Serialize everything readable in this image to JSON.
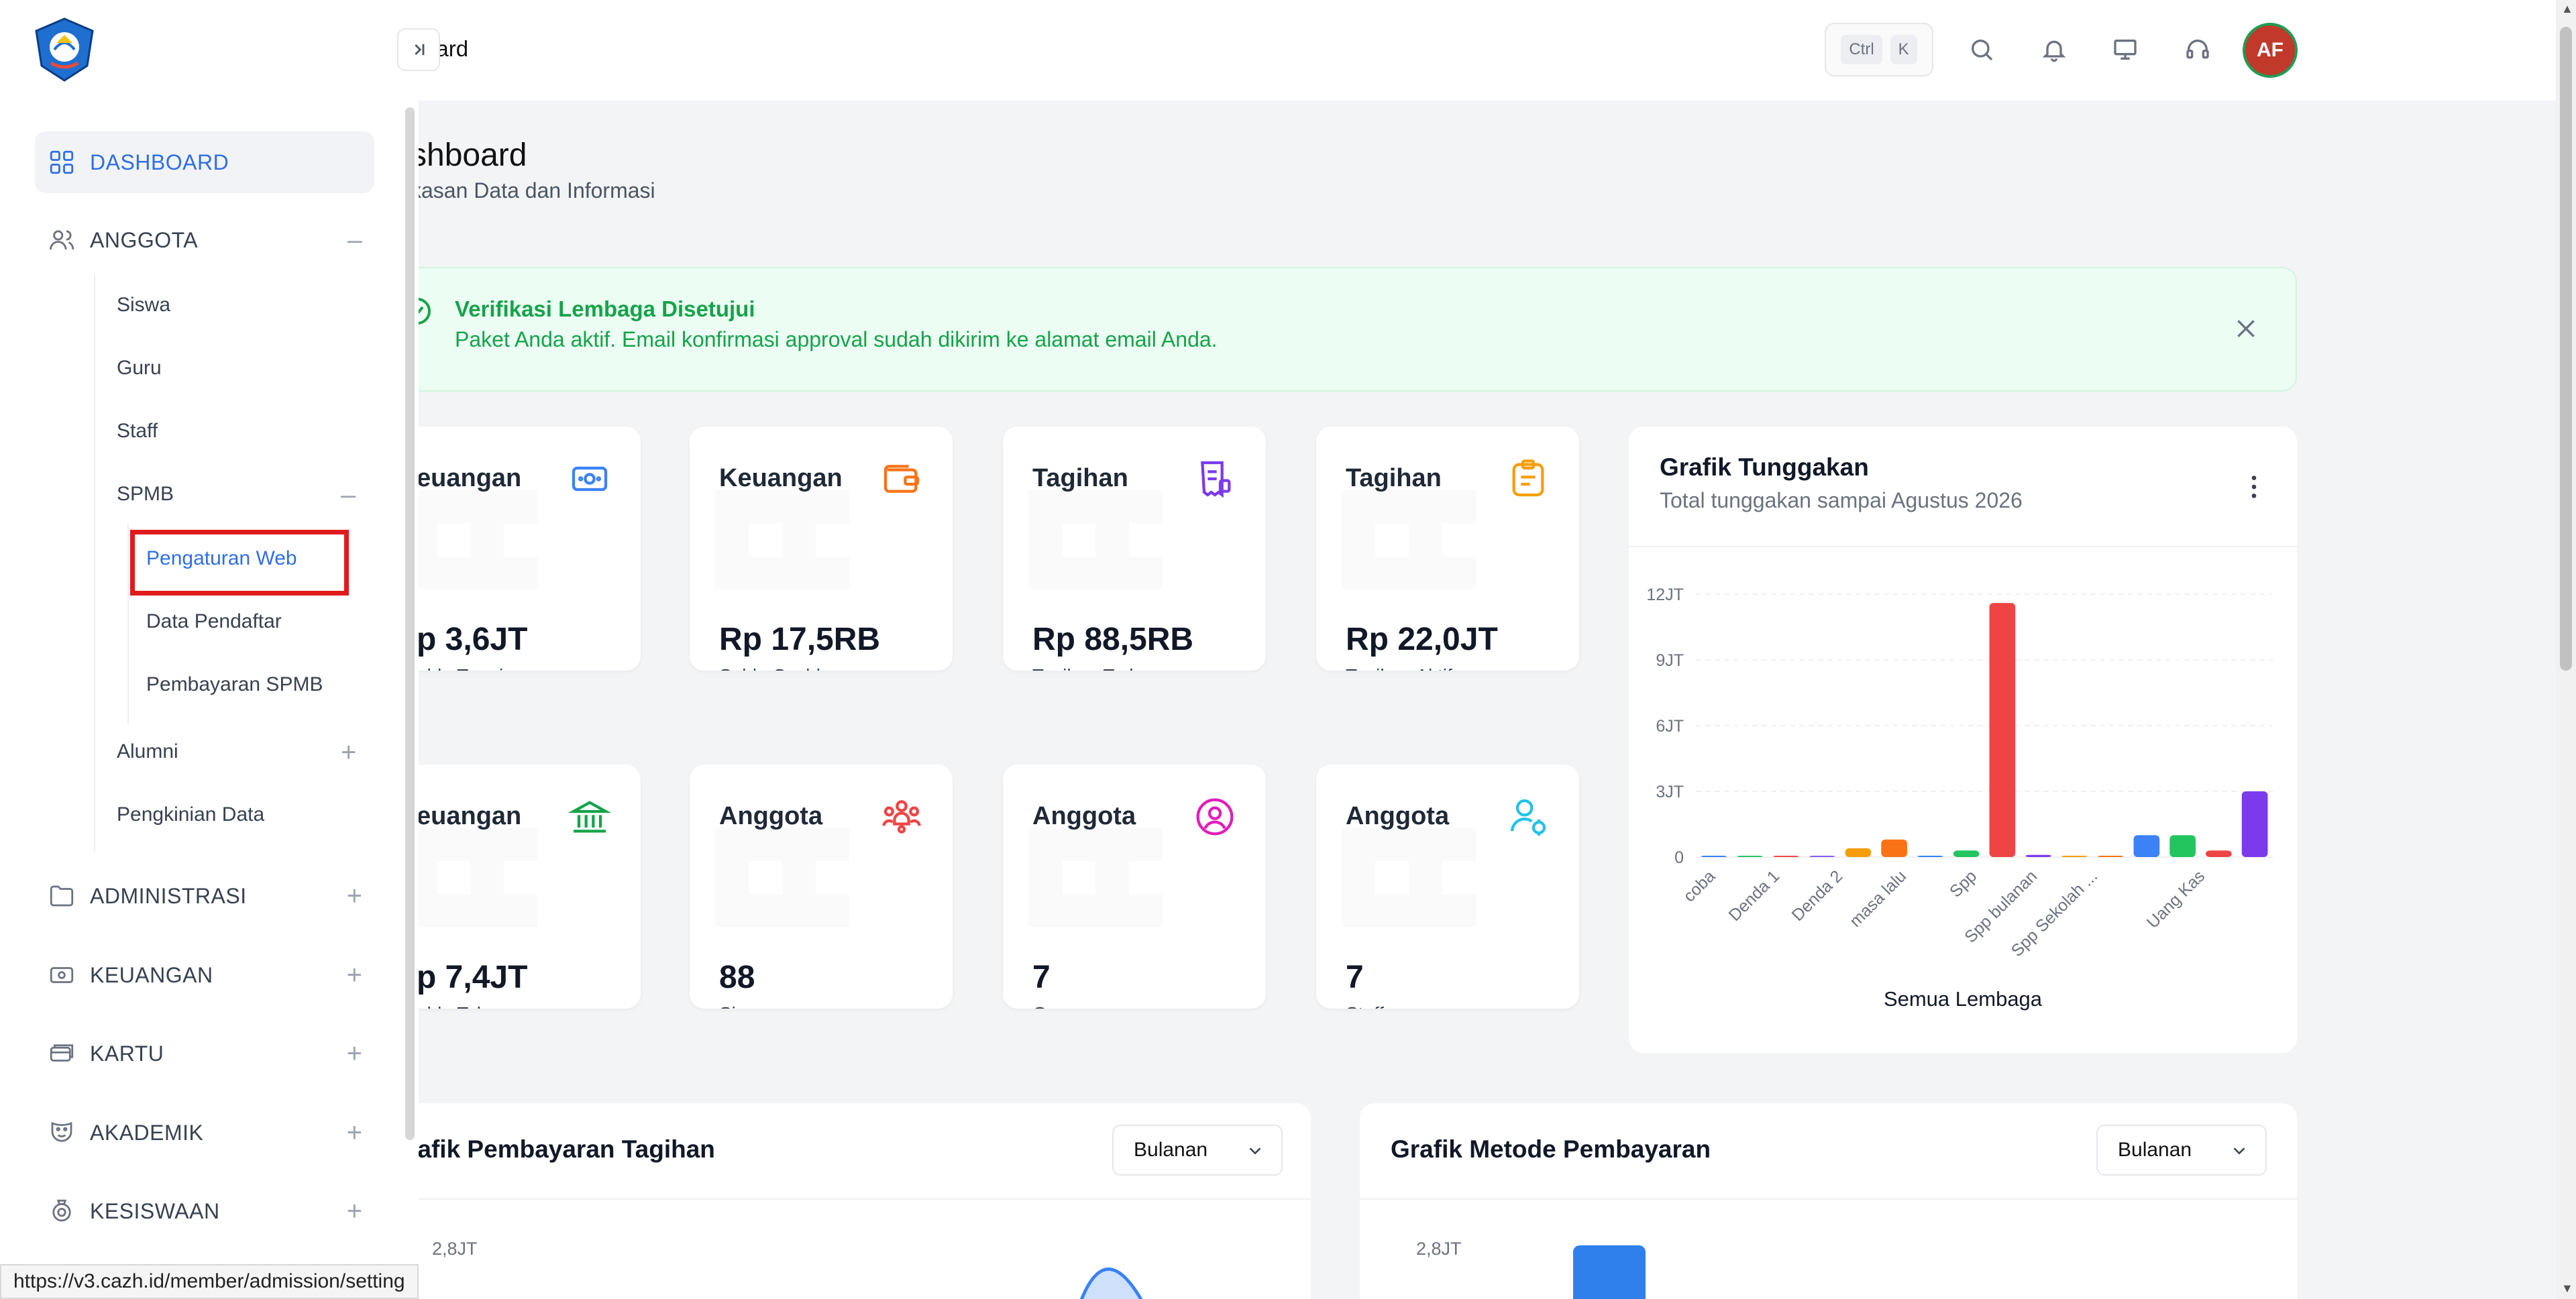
{
  "status_url": "https://v3.cazh.id/member/admission/setting",
  "topbar": {
    "breadcrumb": "oard",
    "shortcut": [
      "Ctrl",
      "K"
    ],
    "avatar_initials": "AF",
    "icons": [
      "search-icon",
      "bell-icon",
      "monitor-icon",
      "headset-icon"
    ]
  },
  "sidebar": {
    "nav": [
      {
        "label": "DASHBOARD",
        "icon": "grid-icon",
        "active": true
      },
      {
        "label": "ANGGOTA",
        "icon": "users-icon",
        "toggle": "–"
      },
      {
        "label": "ADMINISTRASI",
        "icon": "folder-icon",
        "toggle": "+"
      },
      {
        "label": "KEUANGAN",
        "icon": "money-icon",
        "toggle": "+"
      },
      {
        "label": "KARTU",
        "icon": "card-icon",
        "toggle": "+"
      },
      {
        "label": "AKADEMIK",
        "icon": "mask-icon",
        "toggle": "+"
      },
      {
        "label": "KESISWAAN",
        "icon": "badge-icon",
        "toggle": "+"
      }
    ],
    "anggota_children": [
      {
        "label": "Siswa"
      },
      {
        "label": "Guru"
      },
      {
        "label": "Staff"
      },
      {
        "label": "SPMB",
        "toggle": "–"
      },
      {
        "label": "Alumni",
        "toggle": "+"
      },
      {
        "label": "Pengkinian Data"
      }
    ],
    "spmb_children": [
      {
        "label": "Pengaturan Web",
        "active": true
      },
      {
        "label": "Data Pendaftar"
      },
      {
        "label": "Pembayaran SPMB"
      }
    ]
  },
  "page": {
    "title": "shboard",
    "subtitle": "kasan Data dan Informasi"
  },
  "alert": {
    "title": "Verifikasi Lembaga Disetujui",
    "message": "Paket Anda aktif. Email konfirmasi approval sudah dikirim ke alamat email Anda."
  },
  "cards": [
    {
      "title": "euangan",
      "value": "p 3,6JT",
      "label": "aldo Tunai",
      "icon": "cash-icon",
      "color": "#3b82f6"
    },
    {
      "title": "Keuangan",
      "value": "Rp 17,5RB",
      "label": "Saldo Cazhbox",
      "icon": "wallet-icon",
      "color": "#f97316"
    },
    {
      "title": "Tagihan",
      "value": "Rp 88,5RB",
      "label": "Tagihan Terbayar",
      "icon": "receipt-icon",
      "color": "#7c3aed"
    },
    {
      "title": "Tagihan",
      "value": "Rp 22,0JT",
      "label": "Tagihan Aktif",
      "icon": "clipboard-icon",
      "color": "#f59e0b"
    },
    {
      "title": "euangan",
      "value": "p 7,4JT",
      "label": "aldo Tabungan",
      "icon": "bank-icon",
      "color": "#16a34a"
    },
    {
      "title": "Anggota",
      "value": "88",
      "label": "Siswa",
      "icon": "group-icon",
      "color": "#ef4444"
    },
    {
      "title": "Anggota",
      "value": "7",
      "label": "Guru",
      "icon": "user-circle-icon",
      "color": "#e11dbb"
    },
    {
      "title": "Anggota",
      "value": "7",
      "label": "Staff",
      "icon": "user-gear-icon",
      "color": "#22c3e6"
    }
  ],
  "tunggakan": {
    "title": "Grafik Tunggakan",
    "subtitle": "Total tunggakan sampai Agustus 2026",
    "footer": "Semua Lembaga"
  },
  "pembayaran_tagihan": {
    "title": "rafik Pembayaran Tagihan",
    "select": "Bulanan",
    "tick": "2,8JT"
  },
  "metode_pembayaran": {
    "title": "Grafik Metode Pembayaran",
    "select": "Bulanan",
    "tick": "2,8JT"
  },
  "chart_data": {
    "type": "bar",
    "ylim": [
      0,
      12000000
    ],
    "yticks": [
      "0",
      "3JT",
      "6JT",
      "9JT",
      "12JT"
    ],
    "categories": [
      "coba",
      "Denda 1",
      "Denda 2",
      "masa lalu",
      "Spp",
      "Spp bulanan",
      "Spp Sekolah ...",
      "Uang Kas"
    ],
    "values": [
      0,
      0,
      50000,
      20000,
      400000,
      800000,
      0,
      300000,
      11600000,
      100000,
      50000,
      0,
      1000000,
      1000000,
      300000,
      3000000
    ],
    "bar_colors": [
      "#3b82f6",
      "#22c55e",
      "#ef4444",
      "#8b5cf6",
      "#f59e0b",
      "#f97316",
      "#3b82f6",
      "#22c55e",
      "#ef4444",
      "#7c3aed",
      "#f59e0b",
      "#f97316",
      "#3b82f6",
      "#22c55e",
      "#ef4444",
      "#7c3aed"
    ]
  }
}
